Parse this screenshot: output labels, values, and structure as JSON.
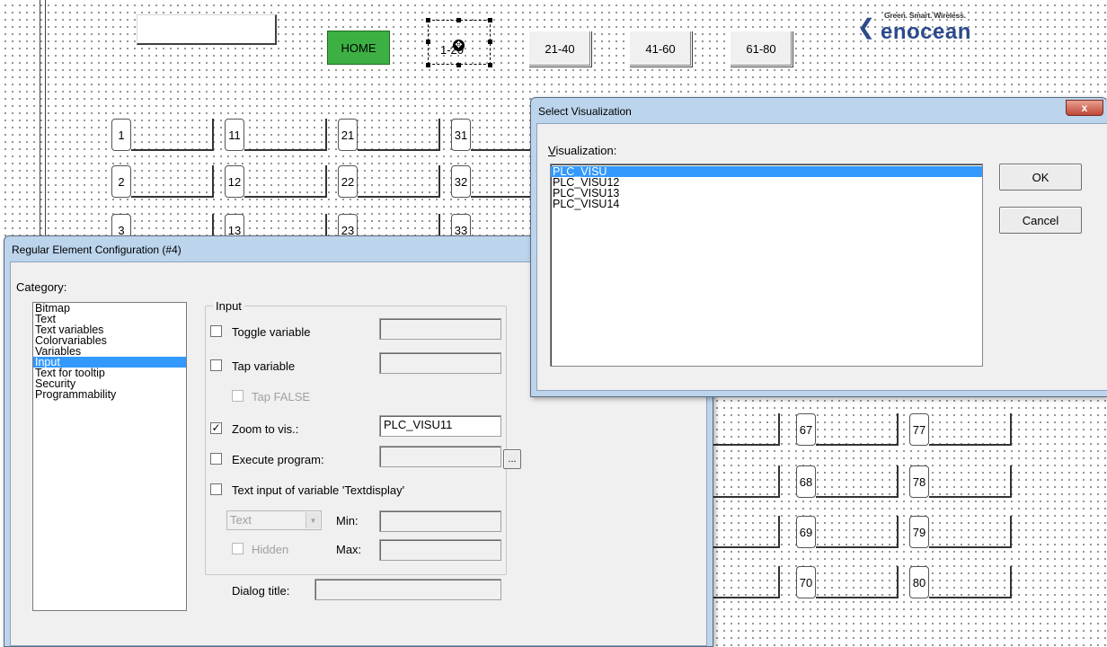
{
  "canvas": {
    "empty_field_button": "",
    "home_button": "HOME",
    "selected_button": "1-20",
    "range_buttons": [
      "21-40",
      "41-60",
      "61-80"
    ],
    "logo": {
      "tagline": "Green. Smart. Wireless.",
      "wordmark": "enocean"
    },
    "row1": [
      "1",
      "11",
      "21",
      "31"
    ],
    "row2": [
      "2",
      "12",
      "22",
      "32"
    ],
    "row3": [
      "3",
      "13",
      "23",
      "33"
    ],
    "right_col1": [
      "67",
      "68",
      "69",
      "70"
    ],
    "right_col2": [
      "77",
      "78",
      "79",
      "80"
    ]
  },
  "select_vis": {
    "title": "Select Visualization",
    "close": "x",
    "label_prefix": "V",
    "label_rest": "isualization:",
    "items": [
      "PLC_VISU",
      "PLC_VISU12",
      "PLC_VISU13",
      "PLC_VISU14"
    ],
    "selected_index": 0,
    "ok": "OK",
    "cancel": "Cancel"
  },
  "config": {
    "title": "Regular Element Configuration (#4)",
    "category_label": "Category:",
    "categories": [
      "Bitmap",
      "Text",
      "Text variables",
      "Colorvariables",
      "Variables",
      "Input",
      "Text for tooltip",
      "Security",
      "Programmability"
    ],
    "selected_category": 5,
    "group_title": "Input",
    "toggle_variable": {
      "label": "Toggle variable",
      "checked": false,
      "value": ""
    },
    "tap_variable": {
      "label": "Tap variable",
      "checked": false,
      "value": ""
    },
    "tap_false": {
      "label": "Tap FALSE",
      "checked": false
    },
    "zoom_to_vis": {
      "label": "Zoom to vis.:",
      "checked": true,
      "value": "PLC_VISU11"
    },
    "execute_program": {
      "label": "Execute program:",
      "checked": false,
      "value": "",
      "browse": "..."
    },
    "text_input": {
      "label": "Text input of variable 'Textdisplay'",
      "checked": false
    },
    "type_combo": "Text",
    "min_label": "Min:",
    "max_label": "Max:",
    "hidden": {
      "label": "Hidden",
      "checked": false
    },
    "dialog_title_label": "Dialog title:",
    "dialog_title_value": ""
  }
}
